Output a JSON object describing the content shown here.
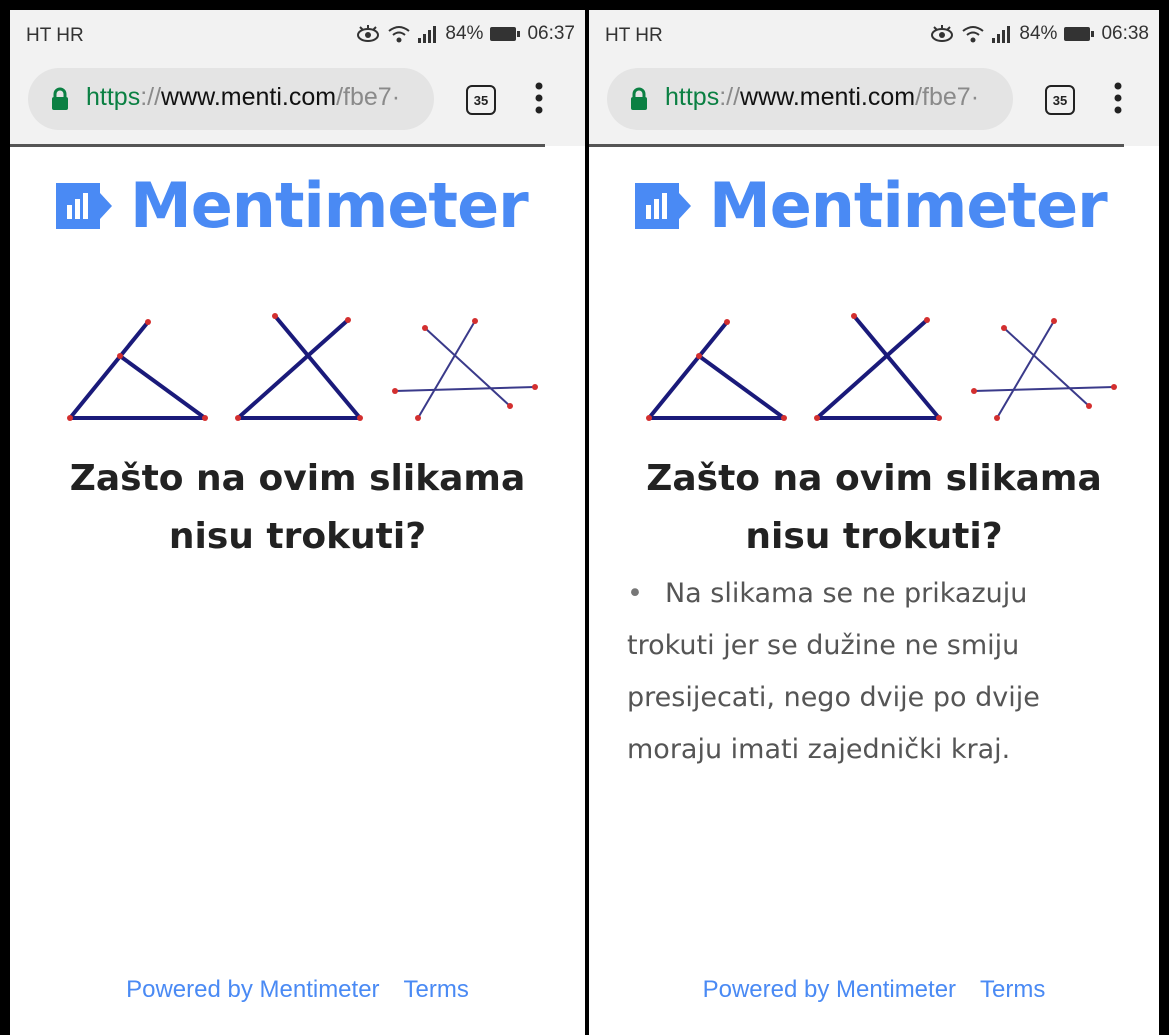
{
  "screens": [
    {
      "status": {
        "carrier": "HT HR",
        "battery": "84%",
        "time": "06:37"
      },
      "browser": {
        "url_scheme": "https",
        "url_sep": "://",
        "url_host": "www.menti.com",
        "url_path": "/fbe7·",
        "tab_count": "35"
      },
      "logo": "Mentimeter",
      "question": {
        "line1": "Zašto na ovim slikama",
        "line2": "nisu trokuti?"
      },
      "answers": [],
      "footer": {
        "powered": "Powered by Mentimeter",
        "terms": "Terms"
      }
    },
    {
      "status": {
        "carrier": "HT HR",
        "battery": "84%",
        "time": "06:38"
      },
      "browser": {
        "url_scheme": "https",
        "url_sep": "://",
        "url_host": "www.menti.com",
        "url_path": "/fbe7·",
        "tab_count": "35"
      },
      "logo": "Mentimeter",
      "question": {
        "line1": "Zašto na ovim slikama",
        "line2": "nisu trokuti?"
      },
      "answers": [
        {
          "lines": [
            "Na slikama se ne prikazuju",
            "trokuti jer se dužine ne smiju",
            "presijecati, nego dvije po dvije",
            "moraju imati zajednički kraj."
          ]
        }
      ],
      "footer": {
        "powered": "Powered by Mentimeter",
        "terms": "Terms"
      }
    }
  ],
  "colors": {
    "brand": "#4a8af4",
    "secure": "#0b8043",
    "line_blue": "#1a1a7a",
    "point_red": "#d32f2f"
  },
  "icons": [
    "eye-comfort-icon",
    "wifi-icon",
    "signal-icon",
    "battery-icon",
    "lock-icon",
    "tab-switcher-icon",
    "more-vert-icon",
    "mentimeter-logo-icon"
  ]
}
